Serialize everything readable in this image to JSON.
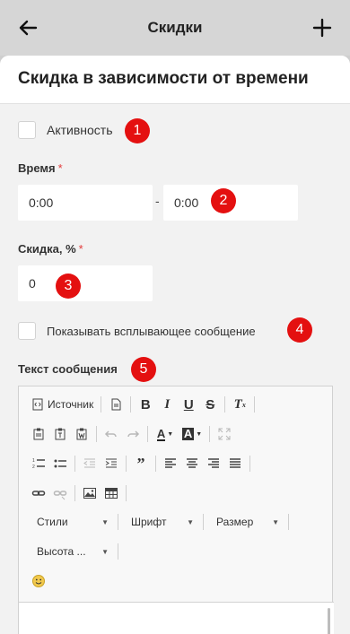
{
  "header": {
    "title": "Скидки"
  },
  "sheet": {
    "title": "Скидка в зависимости от времени"
  },
  "form": {
    "active_label": "Активность",
    "time_label": "Время",
    "required_mark": "*",
    "time_from": "0:00",
    "time_separator": "-",
    "time_to": "0:00",
    "discount_label": "Скидка, %",
    "discount_value": "0",
    "popup_label": "Показывать всплывающее сообщение",
    "message_label": "Текст сообщения"
  },
  "badges": [
    "1",
    "2",
    "3",
    "4",
    "5"
  ],
  "editor": {
    "source_label": "Источник",
    "styles_label": "Стили",
    "font_label": "Шрифт",
    "size_label": "Размер",
    "height_label": "Высота ..."
  },
  "colors": {
    "badge": "#e41010",
    "required": "#e23b3b"
  }
}
